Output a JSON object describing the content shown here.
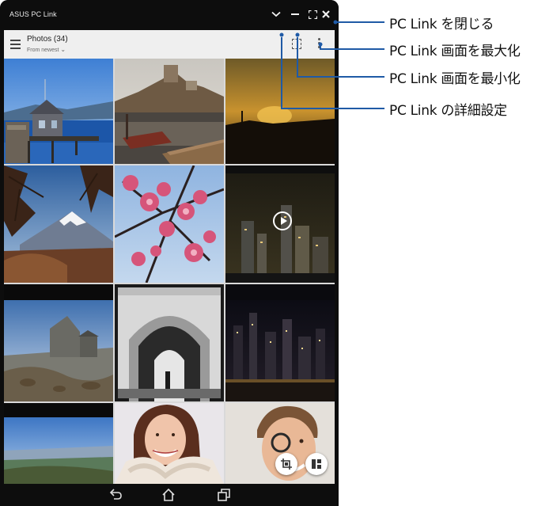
{
  "window": {
    "title": "ASUS PC Link",
    "controls": [
      "chevron-down-icon",
      "minimize-icon",
      "maximize-icon",
      "close-icon"
    ]
  },
  "appbar": {
    "title": "Photos (34)",
    "sort_label": "From newest",
    "sort_icon": "chevron-down-icon",
    "menu_icon": "hamburger-menu-icon",
    "select_icon": "select-icon",
    "overflow_icon": "more-vert-icon"
  },
  "gallery": {
    "items": [
      {
        "subject": "pier-house"
      },
      {
        "subject": "castle-harbor"
      },
      {
        "subject": "sunset"
      },
      {
        "subject": "mount-fuji"
      },
      {
        "subject": "plum-blossoms"
      },
      {
        "subject": "city-night",
        "video": true
      },
      {
        "subject": "stone-church"
      },
      {
        "subject": "stone-arch"
      },
      {
        "subject": "night-skyline"
      },
      {
        "subject": "lake-view"
      },
      {
        "subject": "smiling-woman"
      },
      {
        "subject": "smiling-man"
      }
    ]
  },
  "fabs": [
    "crop-icon",
    "layout-icon"
  ],
  "navigation": [
    "back-icon",
    "home-icon",
    "recent-apps-icon"
  ],
  "callouts": {
    "close": "PC Link を閉じる",
    "maximize": "PC Link 画面を最大化",
    "minimize": "PC Link 画面を最小化",
    "settings": "PC Link の詳細設定"
  },
  "colors": {
    "window_chrome": "#0d0d0d",
    "appbar": "#efefef",
    "callout_line": "#1f5aa6"
  }
}
